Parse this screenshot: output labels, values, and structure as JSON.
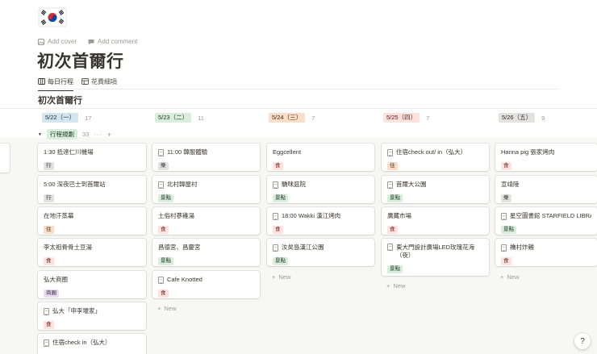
{
  "page": {
    "icon": "south-korea-flag",
    "add_cover": "Add cover",
    "add_comment": "Add comment",
    "title": "初次首爾行"
  },
  "tabs": [
    {
      "label": "每日行程",
      "icon": "board-icon",
      "active": true
    },
    {
      "label": "花費細項",
      "icon": "table-icon",
      "active": false
    }
  ],
  "board_title": "初次首爾行",
  "groups": [
    {
      "label": "5/22（一）",
      "count": "17",
      "pill_bg": "#d3e5ef",
      "pill_fg": "#183347"
    },
    {
      "label": "5/23（二）",
      "count": "11",
      "pill_bg": "#dbeddb",
      "pill_fg": "#1c3829"
    },
    {
      "label": "5/24（三）",
      "count": "7",
      "pill_bg": "#fadec9",
      "pill_fg": "#49290e"
    },
    {
      "label": "5/25（四）",
      "count": "7",
      "pill_bg": "#ffe2dd",
      "pill_fg": "#5d1715"
    },
    {
      "label": "5/26（五）",
      "count": "9",
      "pill_bg": "#e3e2e0",
      "pill_fg": "#32302c"
    }
  ],
  "row": {
    "label": "行程規劃",
    "count": "33",
    "more": "···",
    "add": "+"
  },
  "columns": [
    {
      "cards": [
        {
          "title": "1:30 抵達仁川機場",
          "tag": "行",
          "doc": false
        },
        {
          "title": "5:00 深夜巴士到首爾站",
          "tag": "行",
          "doc": false
        },
        {
          "title": "在地汗蒸幕",
          "tag": "住",
          "doc": false
        },
        {
          "title": "李太祖骨骨土豆湯",
          "tag": "食",
          "doc": false
        },
        {
          "title": "弘大商圈",
          "tag": "商圈",
          "doc": false
        },
        {
          "title": "弘大「申李堰家」",
          "tag": "食",
          "doc": true
        },
        {
          "title": "住宿check in（弘大）",
          "tag": "",
          "doc": true
        }
      ]
    },
    {
      "cards": [
        {
          "title": "11:00 韓服體驗",
          "tag": "樂",
          "doc": true
        },
        {
          "title": "北村韓屋村",
          "tag": "景點",
          "doc": true
        },
        {
          "title": "土俗村蔘雞湯",
          "tag": "食",
          "doc": false
        },
        {
          "title": "昌德宮、昌慶宮",
          "tag": "景點",
          "doc": false
        },
        {
          "title": "Cafe Knotted",
          "tag": "食",
          "doc": true
        }
      ],
      "new": "New"
    },
    {
      "cards": [
        {
          "title": "Eggcellent",
          "tag": "食",
          "doc": false
        },
        {
          "title": "驕咪庭院",
          "tag": "景點",
          "doc": true
        },
        {
          "title": "18:00 Wakki 漢江烤肉",
          "tag": "食",
          "doc": true
        },
        {
          "title": "汝矣島漢江公園",
          "tag": "景點",
          "doc": true
        }
      ],
      "new": "New"
    },
    {
      "cards": [
        {
          "title": "住宿check out/ in（弘大）",
          "tag": "住",
          "doc": true
        },
        {
          "title": "首爾大公園",
          "tag": "景點",
          "doc": true
        },
        {
          "title": "廣藏市場",
          "tag": "食",
          "doc": false
        },
        {
          "title": "東大門設計廣場LED玫瑰花海（夜）",
          "tag": "景點",
          "doc": true
        }
      ],
      "new": "New"
    },
    {
      "cards": [
        {
          "title": "Hanna pig 張家烤肉",
          "tag": "食",
          "doc": false
        },
        {
          "title": "宣靖陵",
          "tag": "樂",
          "doc": false
        },
        {
          "title": "星空圖書館 STARFIELD LIBRARY",
          "tag": "景點",
          "doc": true
        },
        {
          "title": "橋村炸雞",
          "tag": "食",
          "doc": true
        }
      ],
      "new": "New"
    }
  ],
  "help": "?"
}
